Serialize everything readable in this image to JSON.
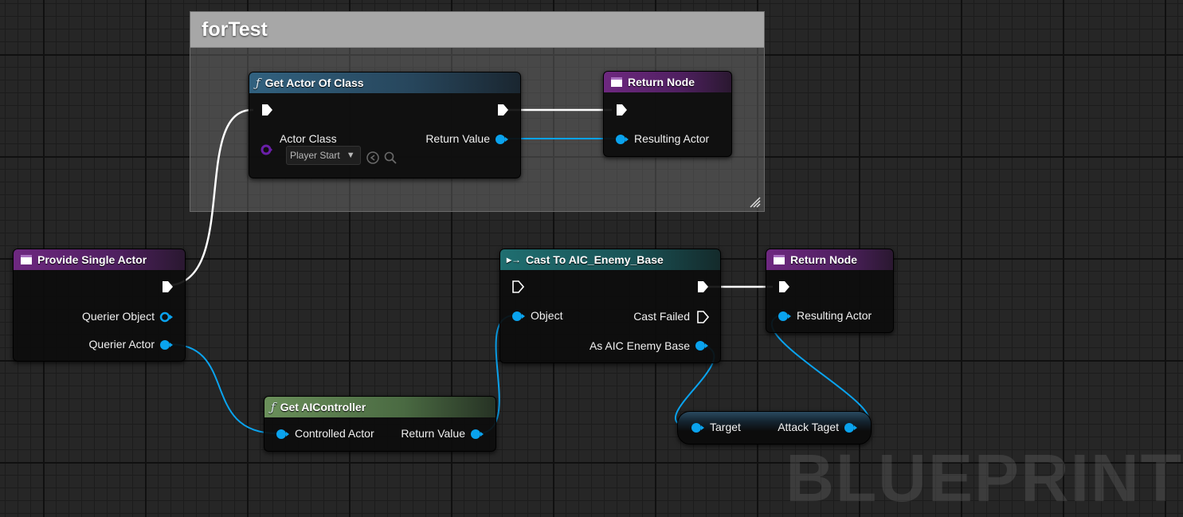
{
  "comment": {
    "title": "forTest"
  },
  "nodes": {
    "get_actor_of_class": {
      "title": "Get Actor Of Class",
      "actor_class_label": "Actor Class",
      "actor_class_value": "Player Start",
      "return_value_label": "Return Value"
    },
    "return_node_top": {
      "title": "Return Node",
      "resulting_actor_label": "Resulting Actor"
    },
    "provide_single_actor": {
      "title": "Provide Single Actor",
      "querier_object_label": "Querier Object",
      "querier_actor_label": "Querier Actor"
    },
    "cast_to": {
      "title": "Cast To AIC_Enemy_Base",
      "object_label": "Object",
      "cast_failed_label": "Cast Failed",
      "as_label": "As AIC Enemy Base"
    },
    "return_node_bottom": {
      "title": "Return Node",
      "resulting_actor_label": "Resulting Actor"
    },
    "get_aicontroller": {
      "title": "Get AIController",
      "controlled_actor_label": "Controlled Actor",
      "return_value_label": "Return Value"
    },
    "attack_target": {
      "target_label": "Target",
      "attack_target_label": "Attack Taget"
    }
  },
  "watermark": "BLUEPRINT",
  "colors": {
    "exec_wire": "#ffffff",
    "object_wire": "#0aa3ee",
    "class_pin": "#5a1a8a",
    "header_function": "#31617f",
    "header_event": "#6e2880",
    "header_pure": "#6a8f5a",
    "header_cast": "#1f6e70"
  }
}
